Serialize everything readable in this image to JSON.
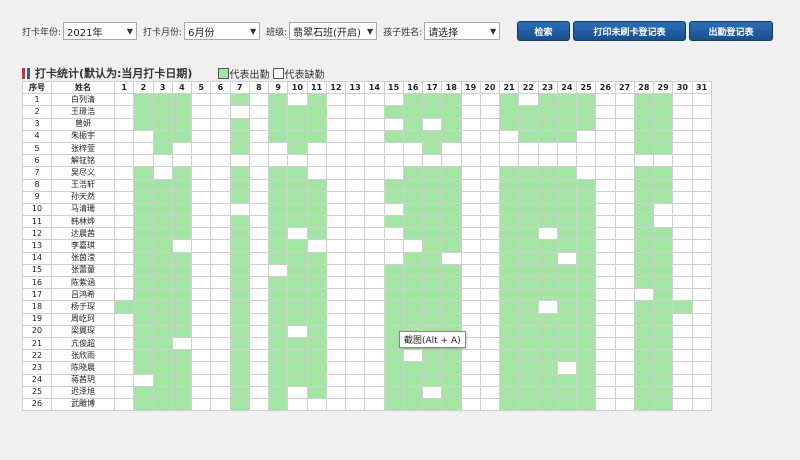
{
  "filters": {
    "year_label": "打卡年份:",
    "year_value": "2021年",
    "month_label": "打卡月份:",
    "month_value": "6月份",
    "class_label": "班级:",
    "class_value": "翡翠石班(开启)",
    "child_label": "孩子姓名:",
    "child_value": "请选择"
  },
  "buttons": {
    "search": "检索",
    "print_unpunched": "打印未刷卡登记表",
    "attendance_register": "出勤登记表"
  },
  "stats": {
    "title": "打卡统计(默认为:当月打卡日期)",
    "legend_present": "代表出勤",
    "legend_absent": "代表缺勤"
  },
  "colors": {
    "present": "#a3e6a3",
    "absent": "#ffffff",
    "button": "#1f5a9e",
    "marker_red": "#cc3333"
  },
  "table": {
    "col_index": "序号",
    "col_name": "姓名",
    "days": [
      "1",
      "2",
      "3",
      "4",
      "5",
      "6",
      "7",
      "8",
      "9",
      "10",
      "11",
      "12",
      "13",
      "14",
      "15",
      "16",
      "17",
      "18",
      "19",
      "20",
      "21",
      "22",
      "23",
      "24",
      "25",
      "26",
      "27",
      "28",
      "29",
      "30",
      "31"
    ],
    "rows": [
      {
        "no": "1",
        "name": "白列清",
        "att": [
          0,
          1,
          1,
          1,
          0,
          0,
          1,
          0,
          1,
          0,
          1,
          0,
          0,
          0,
          0,
          1,
          1,
          1,
          0,
          0,
          1,
          0,
          1,
          1,
          1,
          0,
          0,
          1,
          1,
          0,
          0
        ]
      },
      {
        "no": "2",
        "name": "王璟浩",
        "att": [
          0,
          1,
          1,
          1,
          0,
          0,
          0,
          0,
          1,
          1,
          1,
          0,
          0,
          0,
          1,
          1,
          1,
          1,
          0,
          0,
          1,
          1,
          1,
          1,
          1,
          0,
          0,
          1,
          1,
          0,
          0
        ]
      },
      {
        "no": "3",
        "name": "曾妍",
        "att": [
          0,
          1,
          1,
          1,
          0,
          0,
          1,
          0,
          1,
          1,
          1,
          0,
          0,
          0,
          0,
          1,
          0,
          1,
          0,
          0,
          1,
          1,
          1,
          1,
          1,
          0,
          0,
          1,
          1,
          0,
          0
        ]
      },
      {
        "no": "4",
        "name": "朱振宇",
        "att": [
          0,
          0,
          1,
          1,
          0,
          0,
          1,
          0,
          1,
          1,
          1,
          0,
          0,
          0,
          1,
          1,
          1,
          1,
          0,
          0,
          0,
          1,
          1,
          1,
          0,
          0,
          0,
          1,
          1,
          0,
          0
        ]
      },
      {
        "no": "5",
        "name": "张梓萱",
        "att": [
          0,
          0,
          1,
          0,
          0,
          0,
          1,
          0,
          0,
          1,
          0,
          0,
          0,
          0,
          0,
          0,
          1,
          0,
          0,
          0,
          0,
          0,
          0,
          0,
          0,
          0,
          0,
          1,
          1,
          0,
          0
        ]
      },
      {
        "no": "6",
        "name": "解钲铭",
        "att": [
          0,
          0,
          0,
          0,
          0,
          0,
          0,
          0,
          0,
          0,
          0,
          0,
          0,
          0,
          0,
          0,
          0,
          0,
          0,
          0,
          0,
          0,
          0,
          0,
          0,
          0,
          0,
          0,
          0,
          0,
          0
        ]
      },
      {
        "no": "7",
        "name": "吴尽义",
        "att": [
          0,
          1,
          0,
          1,
          0,
          0,
          1,
          0,
          1,
          1,
          0,
          0,
          0,
          0,
          0,
          1,
          1,
          1,
          0,
          0,
          1,
          1,
          1,
          1,
          0,
          0,
          0,
          1,
          1,
          0,
          0
        ]
      },
      {
        "no": "8",
        "name": "王浩轩",
        "att": [
          0,
          1,
          1,
          1,
          0,
          0,
          1,
          0,
          1,
          1,
          1,
          0,
          0,
          0,
          1,
          1,
          1,
          1,
          0,
          0,
          1,
          1,
          1,
          1,
          1,
          0,
          0,
          1,
          1,
          0,
          0
        ]
      },
      {
        "no": "9",
        "name": "孙天然",
        "att": [
          0,
          1,
          1,
          1,
          0,
          0,
          1,
          0,
          1,
          1,
          1,
          0,
          0,
          0,
          1,
          1,
          1,
          1,
          0,
          0,
          1,
          1,
          1,
          1,
          1,
          0,
          0,
          1,
          1,
          0,
          0
        ]
      },
      {
        "no": "10",
        "name": "马清珊",
        "att": [
          0,
          1,
          1,
          1,
          0,
          0,
          0,
          0,
          1,
          1,
          1,
          0,
          0,
          0,
          0,
          1,
          1,
          1,
          0,
          0,
          1,
          1,
          1,
          1,
          1,
          0,
          0,
          1,
          0,
          0,
          0
        ]
      },
      {
        "no": "11",
        "name": "韩林烨",
        "att": [
          0,
          1,
          1,
          1,
          0,
          0,
          1,
          0,
          1,
          1,
          1,
          0,
          0,
          0,
          1,
          1,
          1,
          1,
          0,
          0,
          1,
          1,
          1,
          1,
          1,
          0,
          0,
          1,
          0,
          0,
          0
        ]
      },
      {
        "no": "12",
        "name": "达晨茜",
        "att": [
          0,
          1,
          1,
          1,
          0,
          0,
          1,
          0,
          1,
          0,
          1,
          0,
          0,
          0,
          0,
          1,
          1,
          1,
          0,
          0,
          1,
          1,
          0,
          1,
          1,
          0,
          0,
          1,
          1,
          0,
          0
        ]
      },
      {
        "no": "13",
        "name": "李嘉琪",
        "att": [
          0,
          1,
          1,
          0,
          0,
          0,
          1,
          0,
          1,
          1,
          0,
          0,
          0,
          0,
          0,
          0,
          1,
          1,
          0,
          0,
          1,
          1,
          1,
          1,
          1,
          0,
          0,
          1,
          1,
          0,
          0
        ]
      },
      {
        "no": "14",
        "name": "张茵滢",
        "att": [
          0,
          1,
          1,
          1,
          0,
          0,
          1,
          0,
          1,
          1,
          1,
          0,
          0,
          0,
          0,
          1,
          1,
          0,
          0,
          0,
          1,
          1,
          1,
          0,
          1,
          0,
          0,
          1,
          1,
          0,
          0
        ]
      },
      {
        "no": "15",
        "name": "张蕾童",
        "att": [
          0,
          1,
          1,
          1,
          0,
          0,
          1,
          0,
          0,
          1,
          1,
          0,
          0,
          0,
          1,
          1,
          1,
          1,
          0,
          0,
          1,
          1,
          1,
          1,
          1,
          0,
          0,
          1,
          1,
          0,
          0
        ]
      },
      {
        "no": "16",
        "name": "陈紫涵",
        "att": [
          0,
          1,
          1,
          1,
          0,
          0,
          1,
          0,
          1,
          1,
          1,
          0,
          0,
          0,
          1,
          1,
          1,
          1,
          0,
          0,
          1,
          1,
          1,
          1,
          1,
          0,
          0,
          1,
          1,
          0,
          0
        ]
      },
      {
        "no": "17",
        "name": "吕鸿希",
        "att": [
          0,
          1,
          1,
          1,
          0,
          0,
          1,
          0,
          1,
          1,
          1,
          0,
          0,
          0,
          1,
          1,
          1,
          1,
          0,
          0,
          1,
          1,
          1,
          1,
          1,
          0,
          0,
          0,
          1,
          0,
          0
        ]
      },
      {
        "no": "18",
        "name": "杨于琛",
        "att": [
          1,
          1,
          1,
          1,
          0,
          0,
          1,
          0,
          1,
          1,
          1,
          0,
          0,
          0,
          1,
          1,
          1,
          1,
          0,
          0,
          1,
          1,
          0,
          1,
          1,
          0,
          0,
          1,
          1,
          1,
          0
        ]
      },
      {
        "no": "19",
        "name": "周屹珂",
        "att": [
          0,
          1,
          1,
          1,
          0,
          0,
          1,
          0,
          1,
          1,
          1,
          0,
          0,
          0,
          1,
          1,
          1,
          1,
          0,
          0,
          1,
          1,
          1,
          1,
          1,
          0,
          0,
          1,
          1,
          0,
          0
        ]
      },
      {
        "no": "20",
        "name": "梁翼琛",
        "att": [
          0,
          1,
          1,
          1,
          0,
          0,
          1,
          0,
          1,
          0,
          1,
          0,
          0,
          0,
          1,
          1,
          1,
          1,
          0,
          0,
          1,
          1,
          1,
          1,
          1,
          0,
          0,
          1,
          1,
          0,
          0
        ]
      },
      {
        "no": "21",
        "name": "亢俊超",
        "att": [
          0,
          1,
          1,
          0,
          0,
          0,
          1,
          0,
          1,
          1,
          1,
          0,
          0,
          0,
          1,
          1,
          1,
          1,
          0,
          0,
          1,
          1,
          1,
          1,
          1,
          0,
          0,
          1,
          1,
          0,
          0
        ]
      },
      {
        "no": "22",
        "name": "张欣雨",
        "att": [
          0,
          1,
          1,
          1,
          0,
          0,
          1,
          0,
          1,
          1,
          1,
          0,
          0,
          0,
          1,
          0,
          1,
          1,
          0,
          0,
          1,
          1,
          1,
          1,
          1,
          0,
          0,
          1,
          1,
          0,
          0
        ]
      },
      {
        "no": "23",
        "name": "陈晓晨",
        "att": [
          0,
          1,
          1,
          1,
          0,
          0,
          1,
          0,
          1,
          1,
          1,
          0,
          0,
          0,
          1,
          1,
          1,
          1,
          0,
          0,
          1,
          1,
          1,
          0,
          1,
          0,
          0,
          1,
          1,
          0,
          0
        ]
      },
      {
        "no": "24",
        "name": "蒋茜玥",
        "att": [
          0,
          0,
          1,
          1,
          0,
          0,
          1,
          0,
          1,
          1,
          1,
          0,
          0,
          0,
          1,
          1,
          1,
          1,
          0,
          0,
          1,
          1,
          1,
          1,
          1,
          0,
          0,
          1,
          1,
          0,
          0
        ]
      },
      {
        "no": "25",
        "name": "迟泽旭",
        "att": [
          0,
          1,
          1,
          1,
          0,
          0,
          1,
          0,
          1,
          0,
          1,
          0,
          0,
          0,
          1,
          1,
          0,
          1,
          0,
          0,
          1,
          1,
          1,
          1,
          1,
          0,
          0,
          1,
          1,
          0,
          0
        ]
      },
      {
        "no": "26",
        "name": "武雕博",
        "att": [
          0,
          1,
          1,
          1,
          0,
          0,
          1,
          0,
          1,
          0,
          0,
          0,
          0,
          0,
          1,
          1,
          1,
          1,
          0,
          0,
          1,
          1,
          1,
          1,
          1,
          0,
          0,
          1,
          1,
          0,
          0
        ]
      }
    ]
  },
  "tooltip": "截图(Alt + A)"
}
